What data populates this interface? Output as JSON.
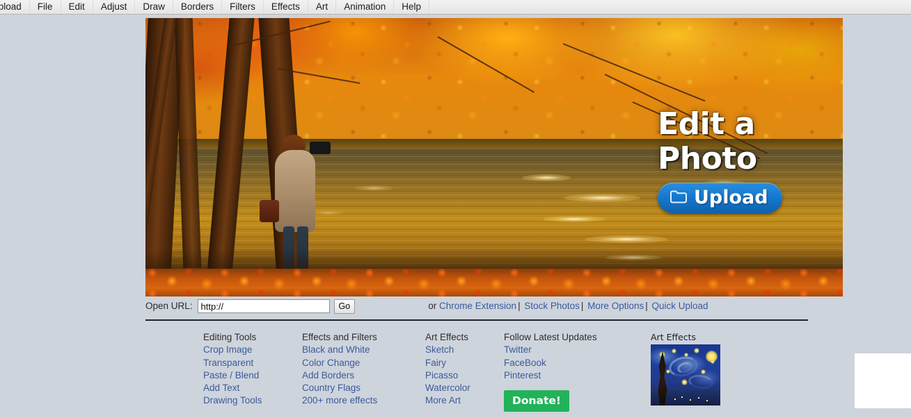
{
  "menubar": {
    "items": [
      {
        "label": "Upload"
      },
      {
        "label": "File"
      },
      {
        "label": "Edit"
      },
      {
        "label": "Adjust"
      },
      {
        "label": "Draw"
      },
      {
        "label": "Borders"
      },
      {
        "label": "Filters"
      },
      {
        "label": "Effects"
      },
      {
        "label": "Art"
      },
      {
        "label": "Animation"
      },
      {
        "label": "Help"
      }
    ]
  },
  "hero": {
    "headline_line1": "Edit a",
    "headline_line2": "Photo",
    "upload_label": "Upload",
    "upload_icon": "folder-icon",
    "image_description": "Autumn forest lake with photographer"
  },
  "url_row": {
    "label": "Open URL:",
    "input_value": "http://",
    "input_placeholder": "http://",
    "go_label": "Go",
    "or_text": "or",
    "links": [
      {
        "label": "Chrome Extension"
      },
      {
        "label": "Stock Photos"
      },
      {
        "label": "More Options"
      },
      {
        "label": "Quick Upload"
      }
    ],
    "separator": "|"
  },
  "footer": {
    "columns": [
      {
        "heading": "Editing Tools",
        "links": [
          {
            "label": "Crop Image"
          },
          {
            "label": "Transparent"
          },
          {
            "label": "Paste / Blend"
          },
          {
            "label": "Add Text"
          },
          {
            "label": "Drawing Tools"
          }
        ]
      },
      {
        "heading": "Effects and Filters",
        "links": [
          {
            "label": "Black and White"
          },
          {
            "label": "Color Change"
          },
          {
            "label": "Add Borders"
          },
          {
            "label": "Country Flags"
          },
          {
            "label": "200+ more effects"
          }
        ]
      },
      {
        "heading": "Art Effects",
        "links": [
          {
            "label": "Sketch"
          },
          {
            "label": "Fairy"
          },
          {
            "label": "Picasso"
          },
          {
            "label": "Watercolor"
          },
          {
            "label": "More Art"
          }
        ]
      },
      {
        "heading": "Follow Latest Updates",
        "links": [
          {
            "label": "Twitter"
          },
          {
            "label": "FaceBook"
          },
          {
            "label": "Pinterest"
          }
        ]
      }
    ],
    "donate_label": "Donate!"
  },
  "art_thumb": {
    "label": "Art Effects",
    "image_description": "Starry Night painting thumbnail"
  },
  "colors": {
    "page_background": "#ced4dc",
    "link": "#3b5a9b",
    "donate_green": "#22b25a",
    "upload_blue": "#1578cd",
    "divider": "#1d2430",
    "menubar_background": "#eaeaea"
  }
}
